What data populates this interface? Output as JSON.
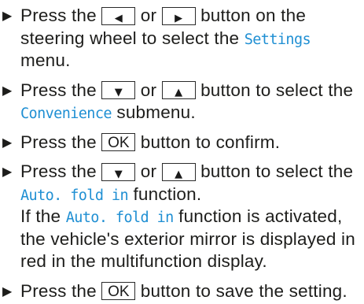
{
  "bullet": "▶",
  "colors": {
    "text": "#1d1d1b",
    "term": "#1f8fd3",
    "key_border": "#2a2a2a",
    "background": "#ffffff"
  },
  "steps": [
    {
      "lines": [
        {
          "text_a": "Press the",
          "key_1": "◀",
          "text_b": "or",
          "key_2": "▶",
          "text_c": "button on the"
        },
        {
          "text_a": "steering wheel to select the",
          "term": "Settings"
        },
        {
          "text_a": "menu."
        }
      ]
    },
    {
      "lines": [
        {
          "text_a": "Press the",
          "key_1": "▼",
          "text_b": "or",
          "key_2": "▲",
          "text_c": "button to select the"
        },
        {
          "term": "Convenience",
          "text_a": "submenu."
        }
      ]
    },
    {
      "lines": [
        {
          "text_a": "Press the",
          "key_1": "OK",
          "text_b": "button to confirm."
        }
      ]
    },
    {
      "lines": [
        {
          "text_a": "Press the",
          "key_1": "▼",
          "text_b": "or",
          "key_2": "▲",
          "text_c": "button to select the"
        },
        {
          "term": "Auto. fold in",
          "text_a": "function."
        },
        {
          "text_a": "If the",
          "term": "Auto. fold in",
          "text_b": "function is activated,"
        },
        {
          "text_a": "the vehicle's exterior mirror is displayed in"
        },
        {
          "text_a": "red in the multifunction display."
        }
      ]
    },
    {
      "lines": [
        {
          "text_a": "Press the",
          "key_1": "OK",
          "text_b": "button to save the setting."
        }
      ]
    }
  ]
}
